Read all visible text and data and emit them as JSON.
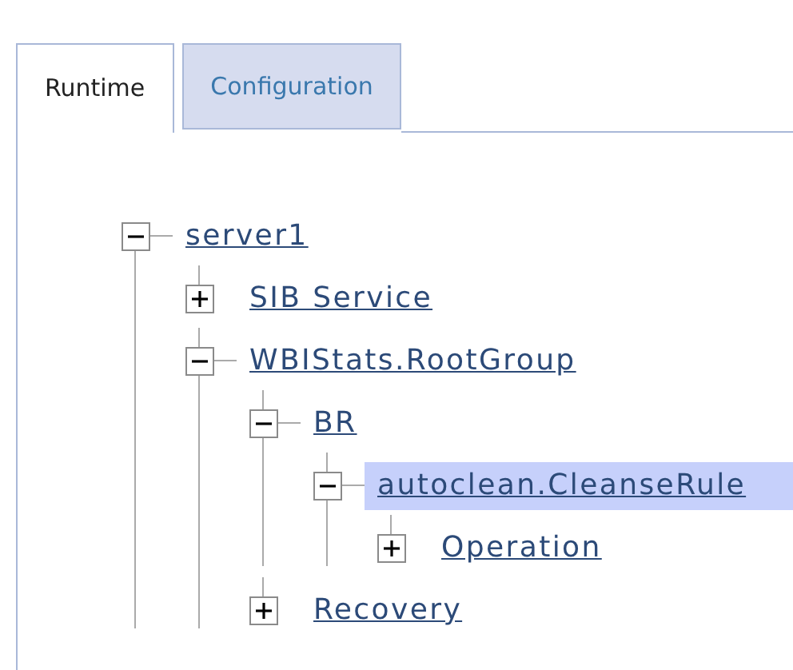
{
  "tabs": [
    {
      "label": "Runtime",
      "selected": true
    },
    {
      "label": "Configuration",
      "selected": false
    }
  ],
  "tree": [
    {
      "label": "server1",
      "expanded": true,
      "selected": false,
      "children": [
        {
          "label": "SIB Service",
          "expanded": false,
          "selected": false
        },
        {
          "label": "WBIStats.RootGroup",
          "expanded": true,
          "selected": false,
          "children": [
            {
              "label": "BR",
              "expanded": true,
              "selected": false,
              "children": [
                {
                  "label": "autoclean.CleanseRule",
                  "expanded": true,
                  "selected": true,
                  "children": [
                    {
                      "label": "Operation",
                      "expanded": false,
                      "selected": false
                    }
                  ]
                }
              ]
            },
            {
              "label": "Recovery",
              "expanded": false,
              "selected": false
            }
          ]
        }
      ]
    }
  ]
}
